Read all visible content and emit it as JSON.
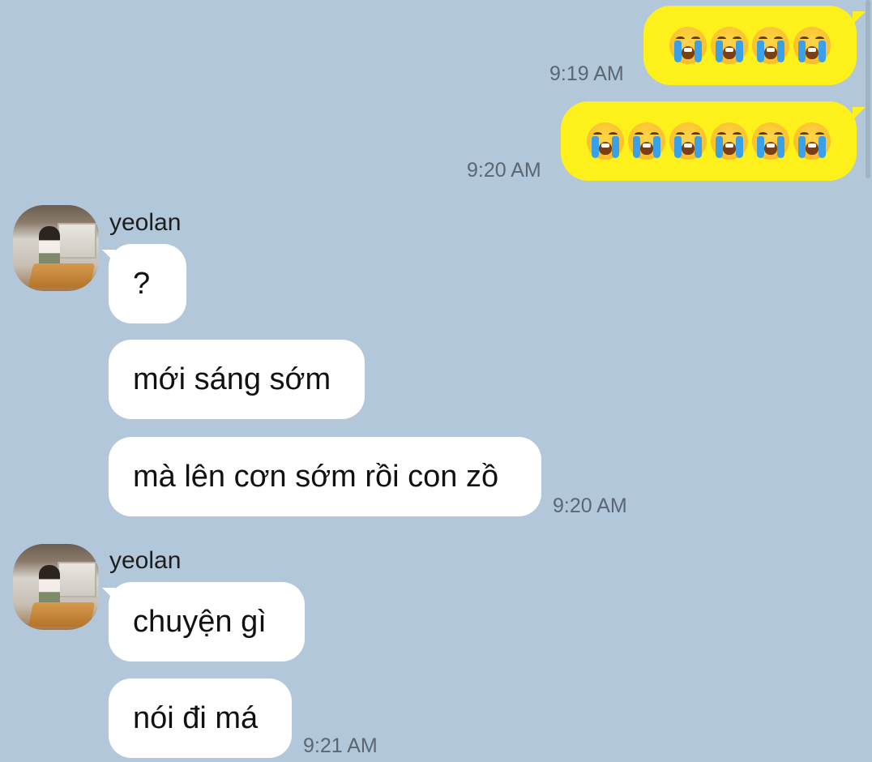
{
  "outgoing": [
    {
      "emoji_name": "loudly-crying-face",
      "emoji_count": 4,
      "time": "9:19 AM"
    },
    {
      "emoji_name": "loudly-crying-face",
      "emoji_count": 6,
      "time": "9:20 AM"
    }
  ],
  "groups": [
    {
      "sender": "yeolan",
      "messages": [
        "?",
        "mới sáng sớm",
        "mà lên cơn sớm rồi con zồ"
      ],
      "time": "9:20 AM"
    },
    {
      "sender": "yeolan",
      "messages": [
        "chuyện gì",
        "nói đi má"
      ],
      "time": "9:21 AM"
    }
  ],
  "colors": {
    "background": "#b2c7da",
    "outgoing_bubble": "#fef01b",
    "incoming_bubble": "#ffffff",
    "timestamp": "#5a6672"
  }
}
